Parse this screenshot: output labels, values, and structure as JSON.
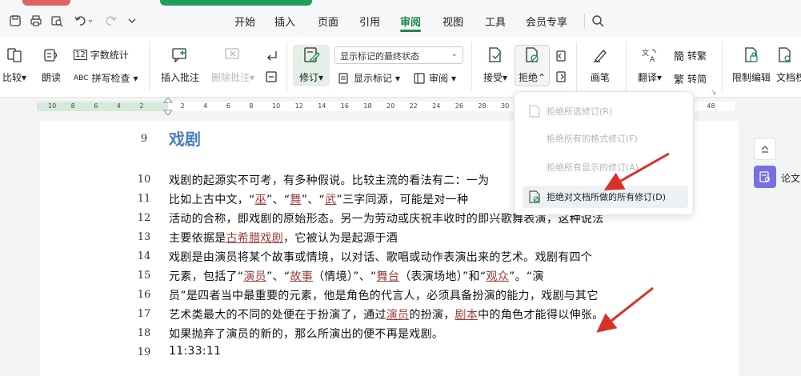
{
  "menu": {
    "tabs": [
      {
        "label": "开始"
      },
      {
        "label": "插入"
      },
      {
        "label": "页面"
      },
      {
        "label": "引用"
      },
      {
        "label": "审阅"
      },
      {
        "label": "视图"
      },
      {
        "label": "工具"
      },
      {
        "label": "会员专享"
      }
    ],
    "active_tab": "审阅"
  },
  "ribbon": {
    "compare": "比较",
    "read_aloud": "朗读",
    "word_count": "字数统计",
    "spell_check": "拼写检查",
    "insert_comment": "插入批注",
    "delete_comment": "删除批注",
    "track_changes": "修订",
    "display_select": "显示标记的最终状态",
    "show_markup": "显示标记",
    "review": "审阅",
    "accept": "接受",
    "reject": "拒绝",
    "brush": "画笔",
    "translate": "翻译",
    "to_traditional": "转繁",
    "to_simplified": "转简",
    "restrict_edit": "限制编辑",
    "doc_permission": "文档权"
  },
  "ruler": {
    "ticks": [
      "10",
      "8",
      "6",
      "4",
      "2",
      "2",
      "4",
      "6",
      "8",
      "10",
      "12",
      "14",
      "16",
      "18",
      "20",
      "22",
      "24",
      "26",
      "28",
      "30",
      "32",
      "34",
      "36",
      "38",
      "40",
      "42",
      "44",
      "46",
      "48"
    ]
  },
  "document": {
    "heading_num": "9",
    "heading": "戏剧",
    "lines": [
      {
        "num": "10",
        "text": "戏剧的起源实不可考，有多种假说。比较主流的看法有二：一为"
      },
      {
        "num": "11",
        "a": "比如上古中文，“",
        "u1": "巫",
        "b": "”、“",
        "u2": "舞",
        "c": "”、“",
        "u3": "武",
        "d": "”三字同源，可能是对一种"
      },
      {
        "num": "12",
        "text": "活动的合称，即戏剧的原始形态。另一为劳动或庆祝丰收时的即兴歌舞表演，这种说法"
      },
      {
        "num": "13",
        "a": "主要依据是",
        "u1": "古希腊戏剧",
        "b": "，它被认为是起源于酒"
      },
      {
        "num": "14",
        "text": "戏剧是由演员将某个故事或情境，以对话、歌唱或动作表演出来的艺术。戏剧有四个"
      },
      {
        "num": "15",
        "a": "元素，包括了“",
        "u1": "演员",
        "b": "”、“",
        "u2": "故事",
        "c": "（情境）”、“",
        "u3": "舞台",
        "d": "（表演场地）”和“",
        "u4": "观众",
        "e": "”。“演"
      },
      {
        "num": "16",
        "text": "员”是四者当中最重要的元素，他是角色的代言人，必须具备扮演的能力，戏剧与其它"
      },
      {
        "num": "17",
        "a": "艺术类最大的不同的处便在于扮演了，通过",
        "u1": "演员",
        "b": "的扮演，",
        "u2": "剧本",
        "c": "中的角色才能得以伸张。"
      },
      {
        "num": "18",
        "text": "如果抛弃了演员的新的，那么所演出的便不再是戏剧。"
      },
      {
        "num": "19",
        "text": "11:33:11"
      }
    ]
  },
  "reject_menu": {
    "items": [
      {
        "label": "拒绝所选修订(R)",
        "enabled": false
      },
      {
        "label": "拒绝所有的格式修订(F)",
        "enabled": false
      },
      {
        "label": "拒绝所有显示的修订(A)",
        "enabled": false
      },
      {
        "label": "拒绝对文档所做的所有修订(D)",
        "enabled": true
      }
    ]
  },
  "side_panel": {
    "paper_label": "论文"
  },
  "colors": {
    "accent": "#1b8a4c",
    "heading": "#4a7fc0",
    "arrow": "#d9302a"
  }
}
